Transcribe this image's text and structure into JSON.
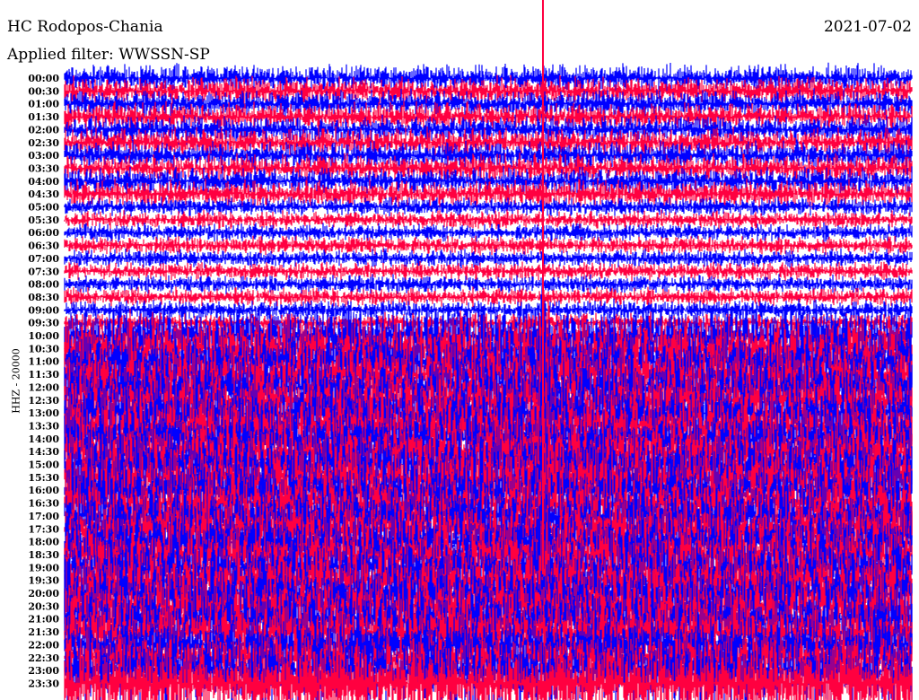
{
  "header": {
    "station": "HC Rodopos-Chania",
    "date": "2021-07-02",
    "filter": "Applied filter: WWSSN-SP"
  },
  "chart_data": {
    "type": "line",
    "title": "HC Rodopos-Chania",
    "ylabel": "HHZ - 20000",
    "channel": "HHZ - 20000",
    "trace_labels": [
      "00:00",
      "00:30",
      "01:00",
      "01:30",
      "02:00",
      "02:30",
      "03:00",
      "03:30",
      "04:00",
      "04:30",
      "05:00",
      "05:30",
      "06:00",
      "06:30",
      "07:00",
      "07:30",
      "08:00",
      "08:30",
      "09:00",
      "09:30",
      "10:00",
      "10:30",
      "11:00",
      "11:30",
      "12:00",
      "12:30",
      "13:00",
      "13:30",
      "14:00",
      "14:30",
      "15:00",
      "15:30",
      "16:00",
      "16:30",
      "17:00",
      "17:30",
      "18:00",
      "18:30",
      "19:00",
      "19:30",
      "20:00",
      "20:30",
      "21:00",
      "21:30",
      "22:00",
      "22:30",
      "23:00",
      "23:30"
    ],
    "series_colors": [
      "#0000ff",
      "#ff0040"
    ],
    "trace_minutes": 30
  }
}
